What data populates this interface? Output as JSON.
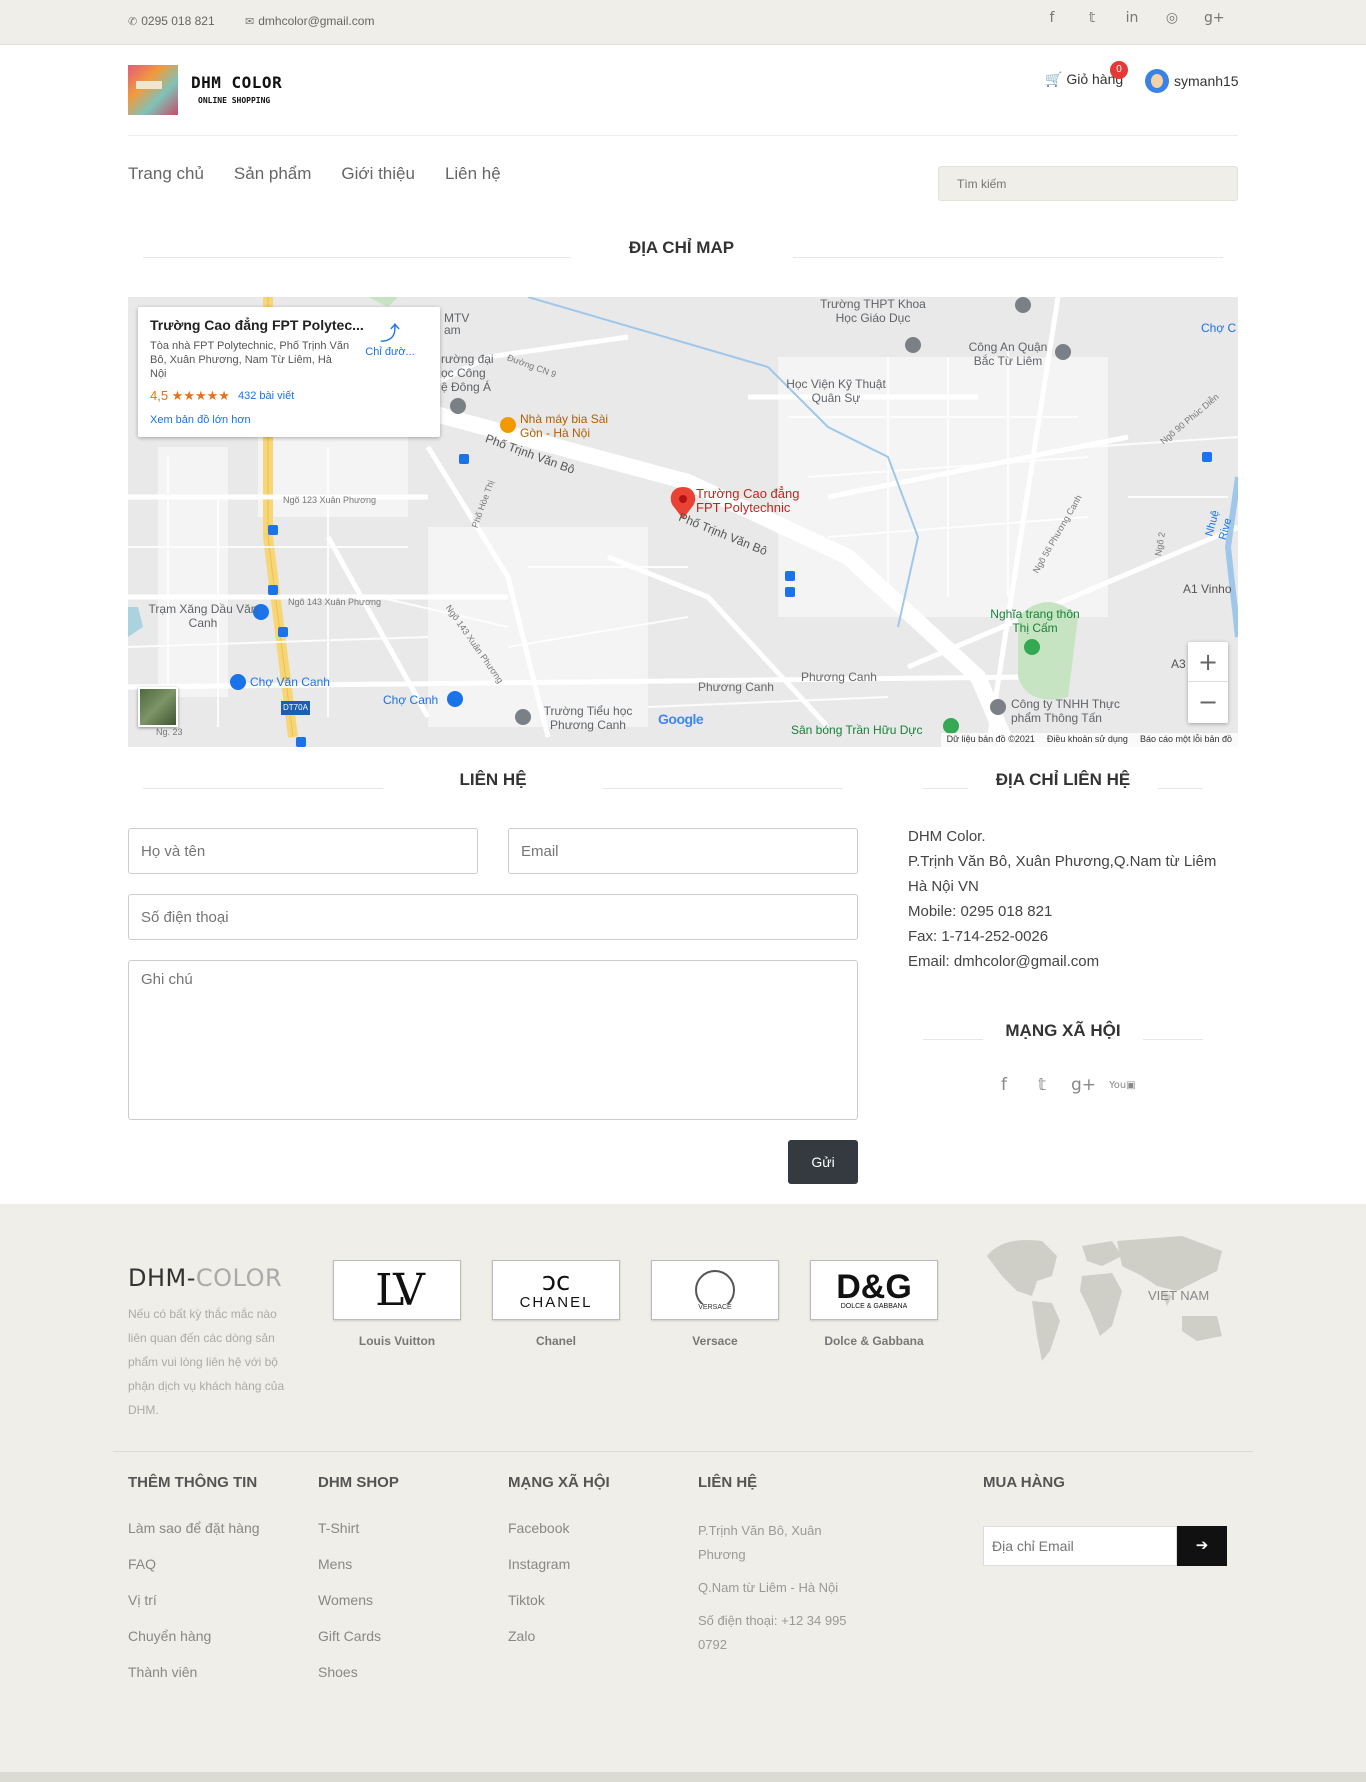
{
  "topbar": {
    "phone": "0295 018 821",
    "email": "dmhcolor@gmail.com",
    "social": [
      "facebook-icon",
      "twitter-icon",
      "linkedin-icon",
      "dribbble-icon",
      "google-plus-icon"
    ]
  },
  "header": {
    "logo_title": "DHM COLOR",
    "logo_sub": "ONLINE SHOPPING",
    "cart_label": "Giỏ hàng",
    "cart_count": "0",
    "username": "symanh15"
  },
  "nav": {
    "items": [
      "Trang chủ",
      "Sản phẩm",
      "Giới thiệu",
      "Liên hệ"
    ],
    "search_placeholder": "Tìm kiếm"
  },
  "map_section": {
    "heading": "ĐỊA CHỈ MAP",
    "card": {
      "title": "Trường Cao đẳng FPT Polytec...",
      "address": "Tòa nhà FPT Polytechnic, Phố Trịnh Văn Bô, Xuân Phương, Nam Từ Liêm, Hà Nội",
      "rating": "4,5 ★★★★★",
      "reviews": "432 bài viết",
      "directions": "Chỉ đườ...",
      "larger_map": "Xem bản đồ lớn hơn"
    },
    "labels": {
      "pin": "Trường Cao đẳng FPT Polytechnic",
      "beer": "Nhà máy bia Sài Gòn - Hà Nội",
      "thpt": "Trường THPT Khoa Học Giáo Dục",
      "police": "Công An Quận Bắc Từ Liêm",
      "academy": "Học Viện Kỹ Thuật Quân Sự",
      "street1": "Phố Trịnh Văn Bô",
      "street2": "Phố Trịnh Văn Bô",
      "gas": "Trạm Xăng Dầu Văn Canh",
      "market1": "Chợ Văn Canh",
      "market2": "Chợ Canh",
      "primary": "Trường Tiểu học Phương Canh",
      "stadium": "Sân bóng Trần Hữu Dực",
      "cemetery": "Nghĩa trang thôn Thị Cấm",
      "company": "Công ty TNHH Thực phẩm Thông Tấn",
      "phuongcanh1": "Phương Canh",
      "phuongcanh2": "Phương Canh",
      "ngo123": "Ngõ 123 Xuân Phương",
      "ngo143": "Ngõ 143 Xuân Phương",
      "ngo143b": "Ngõ 143 Xuân Phương",
      "cn9": "Đường CN 9",
      "a1": "A1 Vinho",
      "a3": "A3",
      "mtv": "MTV",
      "uni": "rường đại",
      "dongA": "ệ Đông Á",
      "cong": "ọc Công",
      "am": "am",
      "cho": "Chợ C",
      "dt70a": "DT70A",
      "ng23": "Ng. 23",
      "hoethi": "Phố Hòe Thị",
      "ngo56": "Ngõ 56 Phương Canh",
      "ngo90": "Ngõ 90 Phúc Diễn",
      "ngo2": "Ngõ 2",
      "river": "Nhuệ Rive"
    },
    "google": "Google",
    "footer": [
      "Dữ liệu bản đồ ©2021",
      "Điều khoản sử dụng",
      "Báo cáo một lỗi bản đồ"
    ]
  },
  "contact": {
    "heading": "LIÊN HỆ",
    "name_placeholder": "Họ và tên",
    "email_placeholder": "Email",
    "phone_placeholder": "Số điện thoại",
    "note_placeholder": "Ghi chú",
    "send": "Gửi"
  },
  "address_block": {
    "heading": "ĐỊA CHỈ LIÊN HỆ",
    "lines": [
      "DHM Color.",
      "P.Trịnh Văn Bô, Xuân Phương,Q.Nam từ Liêm",
      "Hà Nội VN",
      "Mobile: 0295 018 821",
      "Fax: 1-714-252-0026",
      "Email: dmhcolor@gmail.com"
    ],
    "social_heading": "MẠNG XÃ HỘI"
  },
  "footer": {
    "logo_a": "DHM-",
    "logo_b": "COLOR",
    "desc": "Nếu có bất kỳ thắc mắc nào liên quan đến các dòng sản phẩm vui lòng liên hệ với bộ phận dịch vụ khách hàng của DHM.",
    "brands": [
      {
        "name": "Louis Vuitton",
        "mark": "LV"
      },
      {
        "name": "Chanel",
        "mark": "CHANEL"
      },
      {
        "name": "Versace",
        "mark": "VERSACE"
      },
      {
        "name": "Dolce & Gabbana",
        "mark": "D&G",
        "sub": "DOLCE & GABBANA"
      }
    ],
    "map_label": "VIET NAM",
    "cols": [
      {
        "title": "THÊM THÔNG TIN",
        "items": [
          "Làm sao để đặt hàng",
          "FAQ",
          "Vị trí",
          "Chuyển hàng",
          "Thành viên"
        ]
      },
      {
        "title": "DHM SHOP",
        "items": [
          "T-Shirt",
          "Mens",
          "Womens",
          "Gift Cards",
          "Shoes"
        ]
      },
      {
        "title": "MẠNG XÃ HỘI",
        "items": [
          "Facebook",
          "Instagram",
          "Tiktok",
          "Zalo"
        ]
      }
    ],
    "contact_title": "LIÊN HỆ",
    "contact_lines": [
      "P.Trịnh Văn Bô, Xuân Phương",
      "Q.Nam từ Liêm - Hà Nội",
      "Số điện thoại: +12 34 995 0792"
    ],
    "subscribe_title": "MUA HÀNG",
    "subscribe_placeholder": "Địa chỉ Email"
  }
}
